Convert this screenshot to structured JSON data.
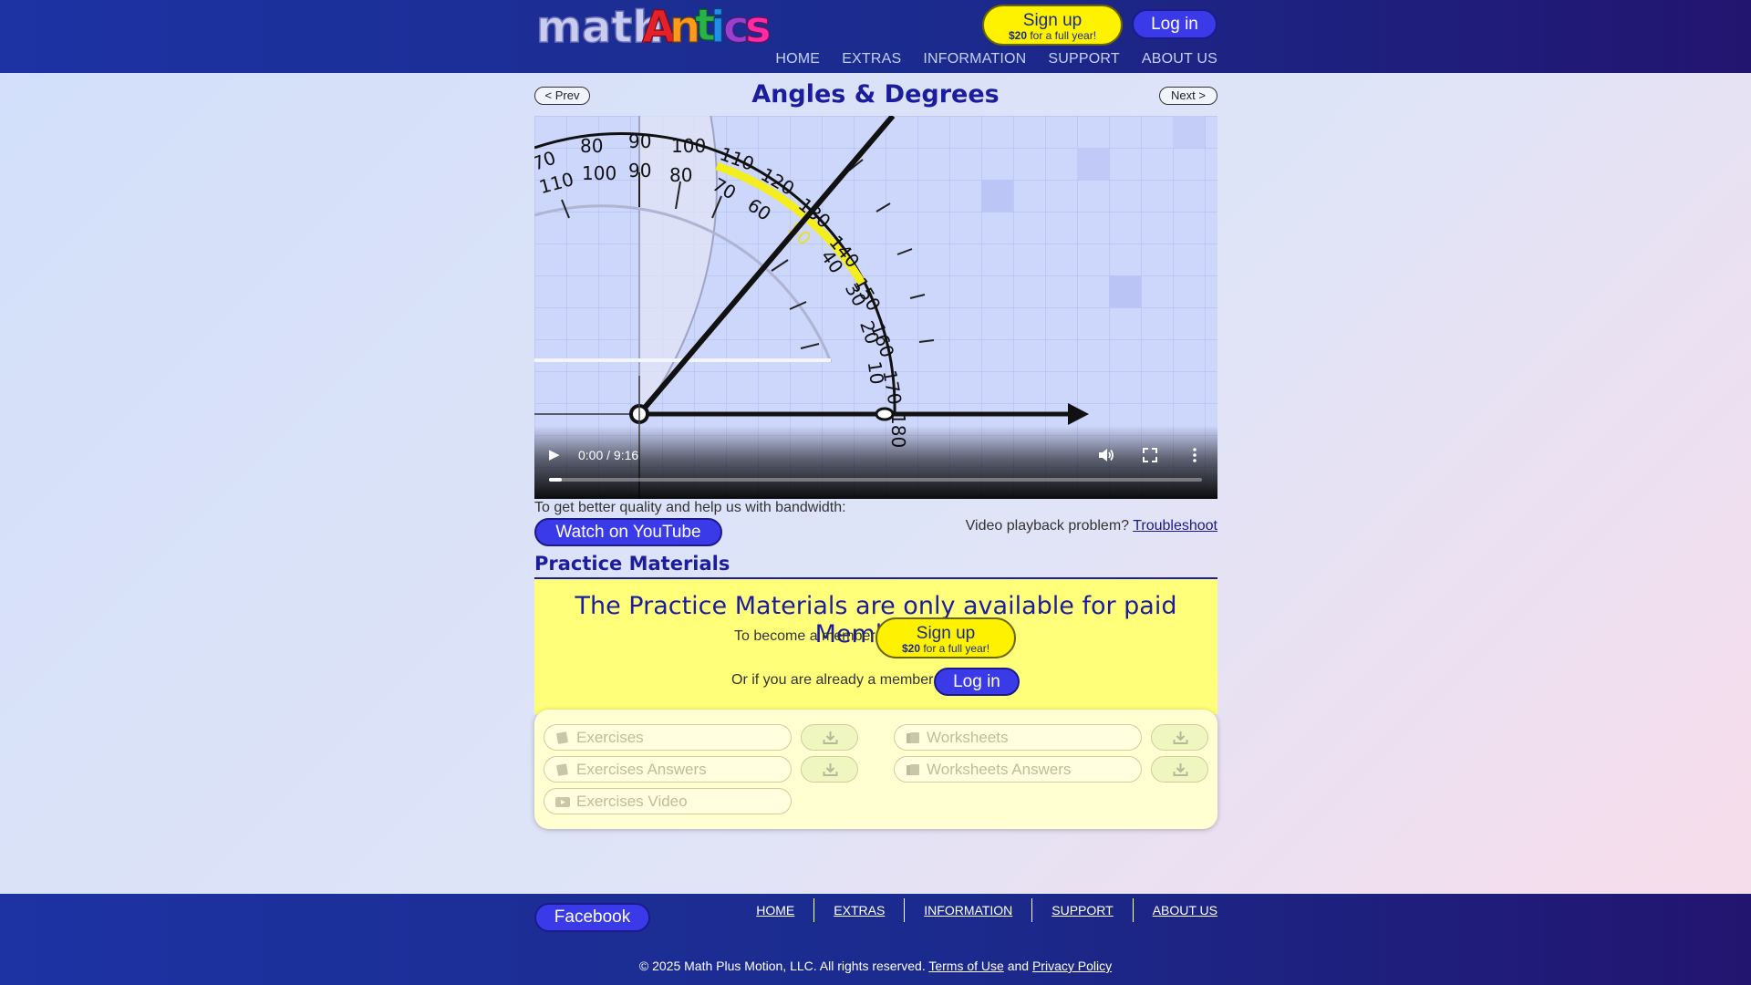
{
  "header": {
    "logo_text_math": "math",
    "logo_text_antics": "Antics",
    "signup_label": "Sign up",
    "signup_price": "$20",
    "signup_suffix": " for a full year!",
    "login_label": "Log in",
    "nav": [
      "HOME",
      "EXTRAS",
      "INFORMATION",
      "SUPPORT",
      "ABOUT US"
    ]
  },
  "lesson": {
    "title": "Angles & Degrees",
    "prev_label": "< Prev",
    "next_label": "Next >"
  },
  "video": {
    "time": "0:00 / 9:16",
    "progress": 0.02,
    "play_icon": "play-icon",
    "volume_icon": "volume-icon",
    "fullscreen_icon": "fullscreen-icon",
    "more_icon": "more-vert-icon",
    "scale_outer": [
      "70",
      "80",
      "90",
      "100",
      "110",
      "120",
      "130",
      "140",
      "150",
      "160",
      "170",
      "180"
    ],
    "scale_inner": [
      "110",
      "100",
      "90",
      "80",
      "70",
      "60",
      "50",
      "40",
      "30",
      "20",
      "10"
    ]
  },
  "bandwidth": {
    "text": "To get better quality and help us with bandwidth:",
    "youtube_label": "Watch on YouTube",
    "problem_text": "Video playback problem?",
    "troubleshoot_label": "Troubleshoot"
  },
  "practice": {
    "section_title": "Practice Materials",
    "headline": "The Practice Materials are only available for paid Members.",
    "become_text": "To become a member:",
    "already_text": "Or if you are already a member:",
    "signup_label": "Sign up",
    "signup_price": "$20",
    "signup_suffix": " for a full year!",
    "login_label": "Log in",
    "items": {
      "exercises": "Exercises",
      "exercises_answers": "Exercises Answers",
      "exercises_video": "Exercises Video",
      "worksheets": "Worksheets",
      "worksheets_answers": "Worksheets Answers"
    }
  },
  "footer": {
    "facebook_label": "Facebook",
    "nav": [
      "HOME",
      "EXTRAS",
      "INFORMATION",
      "SUPPORT",
      "ABOUT US"
    ],
    "copyright_prefix": "© 2025 Math Plus Motion, LLC. All rights reserved.",
    "terms_label": "Terms of Use",
    "and_text": "and",
    "privacy_label": "Privacy Policy"
  },
  "colors": {
    "header_bg": "#1b2a8c",
    "accent_blue": "#3a3ae8",
    "signup_yellow": "#fff200",
    "title_blue": "#1c1c9e",
    "member_box": "#ffff7a",
    "protractor_highlight": "#f4ee1e"
  }
}
